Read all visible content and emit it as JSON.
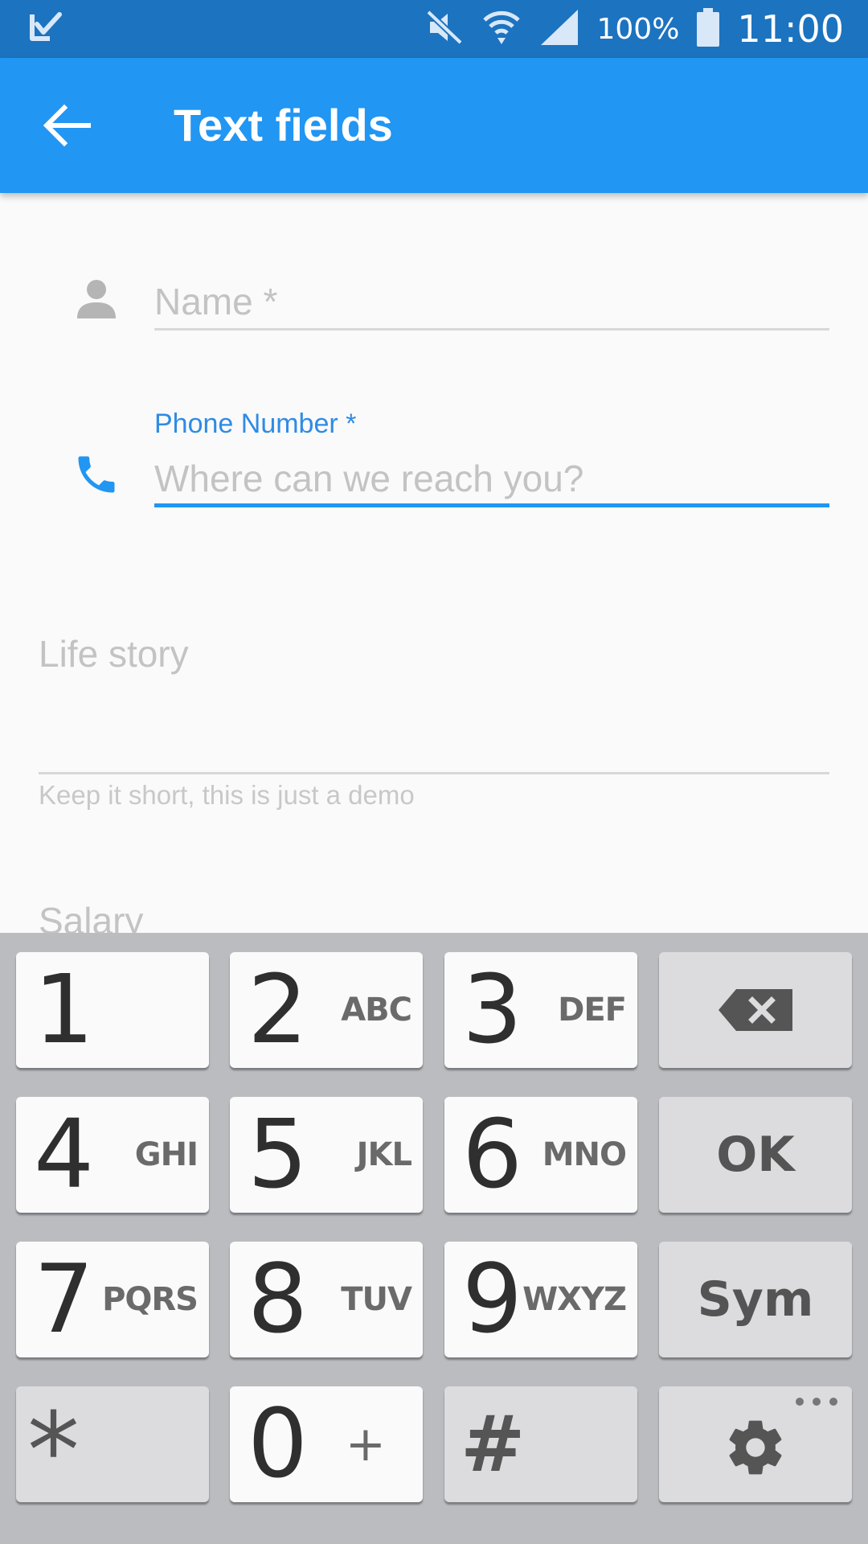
{
  "status_bar": {
    "battery_text": "100%",
    "time": "11:00",
    "icons": [
      "notification-check-icon",
      "mute-icon",
      "wifi-icon",
      "signal-icon",
      "battery-icon"
    ]
  },
  "app_bar": {
    "title": "Text fields",
    "back_icon": "arrow-left-icon",
    "background": "#2196f3"
  },
  "form": {
    "name": {
      "placeholder": "Name *",
      "icon": "person-icon"
    },
    "phone": {
      "label": "Phone Number *",
      "placeholder": "Where can we reach you?",
      "icon": "phone-icon",
      "accent": "#2196f3"
    },
    "life_story": {
      "placeholder": "Life story",
      "helper": "Keep it short, this is just a demo"
    },
    "salary": {
      "placeholder": "Salary"
    }
  },
  "keyboard": {
    "rows": [
      [
        {
          "num": "1",
          "letters": ""
        },
        {
          "num": "2",
          "letters": "ABC"
        },
        {
          "num": "3",
          "letters": "DEF"
        },
        {
          "special": "backspace"
        }
      ],
      [
        {
          "num": "4",
          "letters": "GHI"
        },
        {
          "num": "5",
          "letters": "JKL"
        },
        {
          "num": "6",
          "letters": "MNO"
        },
        {
          "label": "OK"
        }
      ],
      [
        {
          "num": "7",
          "letters": "PQRS"
        },
        {
          "num": "8",
          "letters": "TUV"
        },
        {
          "num": "9",
          "letters": "WXYZ"
        },
        {
          "label": "Sym"
        }
      ],
      [
        {
          "label": "*"
        },
        {
          "num": "0",
          "letters": "+"
        },
        {
          "label": "#"
        },
        {
          "special": "settings"
        }
      ]
    ]
  }
}
